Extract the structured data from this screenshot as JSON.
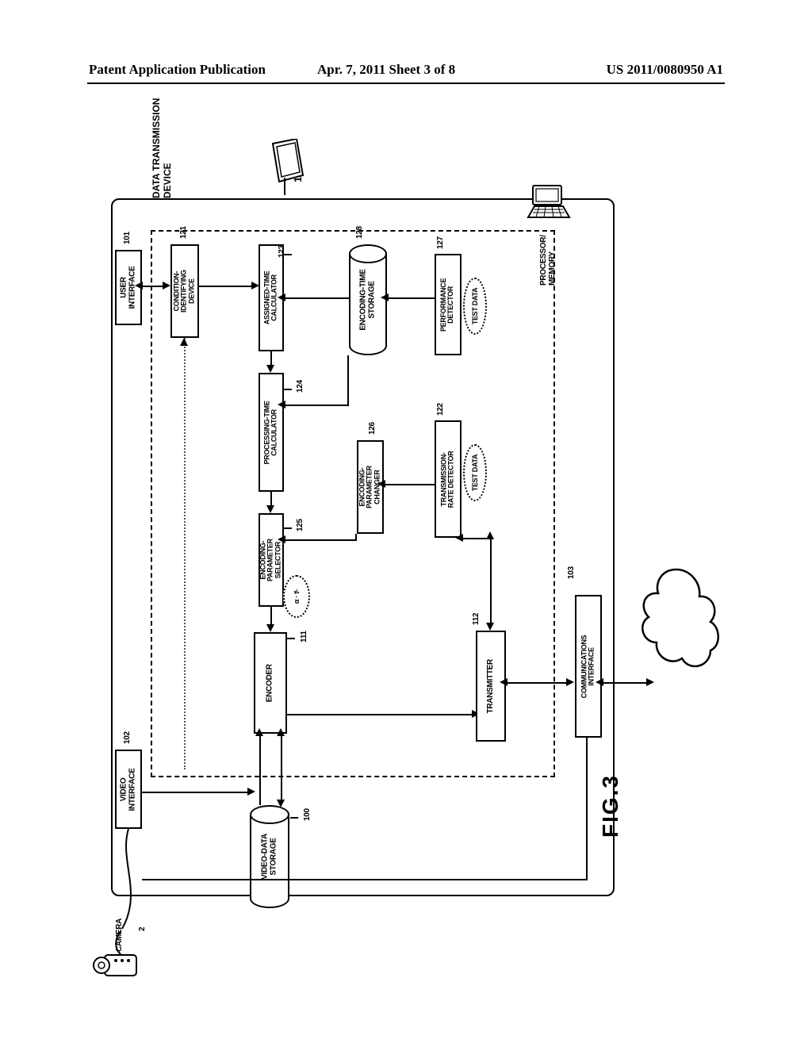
{
  "header": {
    "left": "Patent Application Publication",
    "center": "Apr. 7, 2011  Sheet 3 of 8",
    "right": "US 2011/0080950 A1"
  },
  "figure": {
    "id": "FIG.3",
    "device_label": "DATA TRANSMISSION\nDEVICE",
    "camera_label": "CAMERA",
    "refs": {
      "device": "1",
      "camera": "2",
      "video_data_storage": "100",
      "user_interface": "101",
      "video_interface": "102",
      "communications_interface": "103",
      "encoder": "111",
      "transmitter": "112",
      "condition_identifying": "121",
      "transmission_rate_detector": "122",
      "assigned_time_calc": "123",
      "processing_time_calc": "124",
      "encoding_param_selector": "125",
      "encoding_param_changer": "126",
      "performance_detector": "127",
      "encoding_time_storage": "128"
    },
    "blocks": {
      "user_interface": "USER\nINTERFACE",
      "video_interface": "VIDEO\nINTERFACE",
      "condition_identifying": "CONDITION-\nIDENTIFYING\nDEVICE",
      "assigned_time_calc": "ASSIGNED-TIME\nCALCULATOR",
      "processing_time_calc": "PROCESSING-TIME\nCALCULATOR",
      "encoding_param_selector": "ENCODING-\nPARAMETER\nSELECTOR",
      "encoder": "ENCODER",
      "encoding_time_storage": "ENCODING-TIME\nSTORAGE",
      "encoding_param_changer": "ENCODING-\nPARAMETER\nCHANGER",
      "performance_detector": "PERFORMANCE\nDETECTOR",
      "transmission_rate_detector": "TRANSMISSION-\nRATE DETECTOR",
      "transmitter": "TRANSMITTER",
      "communications_interface": "COMMUNICATIONS\nINTERFACE",
      "video_data_storage": "VIDEO-DATA\nSTORAGE",
      "processor_memory": "PROCESSOR/\nMEMORY"
    },
    "annotations": {
      "test_data": "TEST DATA",
      "alpha_t": "α · tᴸ"
    }
  }
}
